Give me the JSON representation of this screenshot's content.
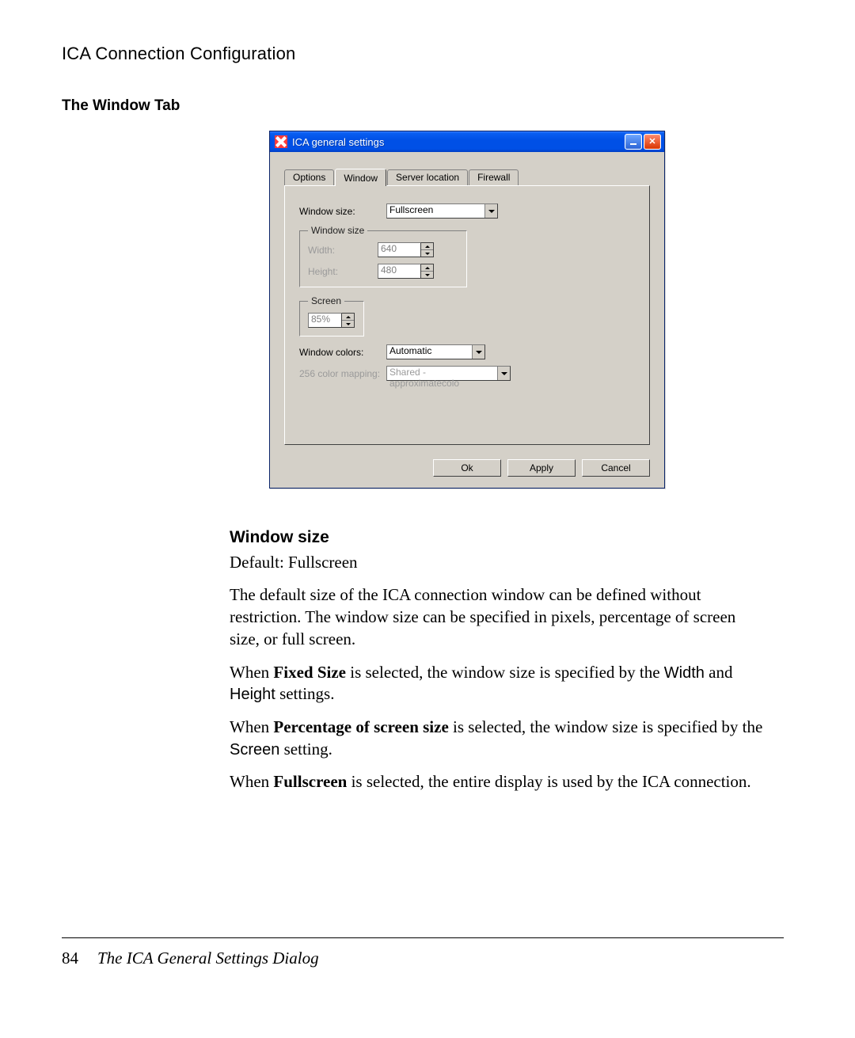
{
  "doc": {
    "running_head": "ICA Connection Configuration",
    "section_title": "The Window Tab",
    "page_number": "84",
    "footer_title": "The ICA General Settings Dialog"
  },
  "dialog": {
    "title": "ICA general settings",
    "tabs": {
      "options": "Options",
      "window": "Window",
      "server_location": "Server location",
      "firewall": "Firewall"
    },
    "fields": {
      "window_size_label": "Window size:",
      "window_size_value": "Fullscreen",
      "group_window_size": "Window size",
      "width_label": "Width:",
      "width_value": "640",
      "height_label": "Height:",
      "height_value": "480",
      "group_screen": "Screen",
      "screen_value": "85%",
      "window_colors_label": "Window colors:",
      "window_colors_value": "Automatic",
      "color_mapping_label": "256 color mapping:",
      "color_mapping_value": "Shared - approximatecolo"
    },
    "buttons": {
      "ok": "Ok",
      "apply": "Apply",
      "cancel": "Cancel"
    }
  },
  "body": {
    "h_window_size": "Window size",
    "default_line": "Default: Fullscreen",
    "p1": "The default size of the ICA connection window can be defined without restriction. The window size can be specified in pixels, percentage of screen size, or full screen.",
    "p2_a": "When ",
    "p2_b": "Fixed Size",
    "p2_c": " is selected, the window size is specified by the ",
    "p2_d": "Width",
    "p2_e": " and ",
    "p2_f": "Height",
    "p2_g": " settings.",
    "p3_a": "When ",
    "p3_b": "Percentage of screen size",
    "p3_c": " is selected, the window size is specified by the ",
    "p3_d": "Screen",
    "p3_e": " setting.",
    "p4_a": "When ",
    "p4_b": "Fullscreen",
    "p4_c": " is selected, the entire display is used by the ICA connection."
  }
}
